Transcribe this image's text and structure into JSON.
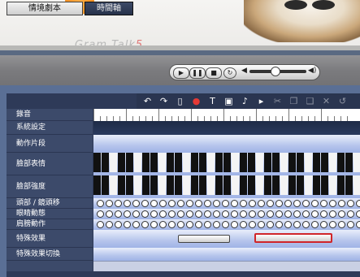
{
  "stage": {
    "brand": "Gram Talk",
    "brand_suffix": "5"
  },
  "transport": {
    "play": "▶",
    "pause": "❚❚",
    "stop": "■",
    "loop": "↻",
    "vol_left": "◀",
    "vol_right": "◀)"
  },
  "tabs": {
    "script": "情境劇本",
    "timeline": "時間軸"
  },
  "toolbar": {
    "icons": [
      "undo-icon",
      "redo-icon",
      "new-page-icon",
      "record-icon",
      "text-icon",
      "image-icon",
      "music-icon",
      "cursor-icon",
      "scissors-icon",
      "copy-icon",
      "paste-icon",
      "delete-icon",
      "refresh-icon"
    ],
    "glyphs": [
      "↶",
      "↷",
      "▯",
      "●",
      "T",
      "▣",
      "♪",
      "▸",
      "✂",
      "❐",
      "❑",
      "✕",
      "↺"
    ]
  },
  "tracks": [
    {
      "label": "錄音"
    },
    {
      "label": "系統設定"
    },
    {
      "label": "動作片段"
    },
    {
      "label": "臉部表情"
    },
    {
      "label": "臉部強度"
    },
    {
      "label": "頭部 / 鏡頭移"
    },
    {
      "label": "眼睛動態"
    },
    {
      "label": "肩膀動作"
    },
    {
      "label": "特殊效果"
    },
    {
      "label": "特殊效果切換"
    }
  ],
  "colors": {
    "accent_red": "#d0252a",
    "track_blue": "#9fb3e6",
    "panel": "#3c4a6a"
  }
}
